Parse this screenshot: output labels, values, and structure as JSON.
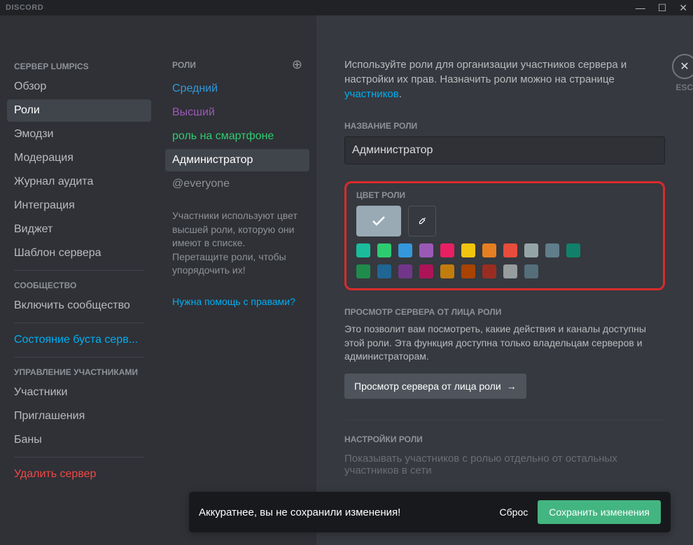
{
  "titlebar": {
    "logo": "DISCORD"
  },
  "sidebar": {
    "server_heading": "СЕРВЕР LUMPICS",
    "items_a": [
      "Обзор",
      "Роли",
      "Эмодзи",
      "Модерация",
      "Журнал аудита",
      "Интеграция",
      "Виджет",
      "Шаблон сервера"
    ],
    "active_index": 1,
    "community_heading": "СООБЩЕСТВО",
    "community_item": "Включить сообщество",
    "boost_status": "Состояние буста серв...",
    "members_heading": "УПРАВЛЕНИЕ УЧАСТНИКАМИ",
    "members_items": [
      "Участники",
      "Приглашения",
      "Баны"
    ],
    "delete": "Удалить сервер"
  },
  "roles": {
    "heading": "РОЛИ",
    "list": [
      {
        "label": "Средний",
        "color": "#3498db"
      },
      {
        "label": "Высший",
        "color": "#9b59b6"
      },
      {
        "label": "роль на смартфоне",
        "color": "#2ecc71"
      },
      {
        "label": "Администратор",
        "color": "#ffffff"
      },
      {
        "label": "@everyone",
        "color": "#8e9297"
      }
    ],
    "selected_index": 3,
    "info": "Участники используют цвет высшей роли, которую они имеют в списке. Перетащите роли, чтобы упорядочить их!",
    "help": "Нужна помощь с правами?"
  },
  "content": {
    "intro_a": "Используйте роли для организации участников сервера и настройки их прав. Назначить роли можно на странице ",
    "intro_link": "участников",
    "name_label": "НАЗВАНИЕ РОЛИ",
    "name_value": "Администратор",
    "color_label": "ЦВЕТ РОЛИ",
    "colors_row1": [
      "#1abc9c",
      "#2ecc71",
      "#3498db",
      "#9b59b6",
      "#e91e63",
      "#f1c40f",
      "#e67e22",
      "#e74c3c",
      "#95a5a6",
      "#607d8b"
    ],
    "colors_row2": [
      "#11806a",
      "#1f8b4c",
      "#206694",
      "#71368a",
      "#ad1457",
      "#c27c0e",
      "#a84300",
      "#992d22",
      "#979c9f",
      "#546e7a"
    ],
    "preview_label": "ПРОСМОТР СЕРВЕРА ОТ ЛИЦА РОЛИ",
    "preview_desc": "Это позволит вам посмотреть, какие действия и каналы доступны этой роли. Эта функция доступна только владельцам серверов и администраторам.",
    "preview_btn": "Просмотр сервера от лица роли",
    "settings_label": "НАСТРОЙКИ РОЛИ",
    "settings_hint": "Показывать участников с ролью отдельно от остальных участников в сети",
    "close_label": "ESC"
  },
  "savebar": {
    "msg": "Аккуратнее, вы не сохранили изменения!",
    "reset": "Сброс",
    "save": "Сохранить изменения"
  }
}
